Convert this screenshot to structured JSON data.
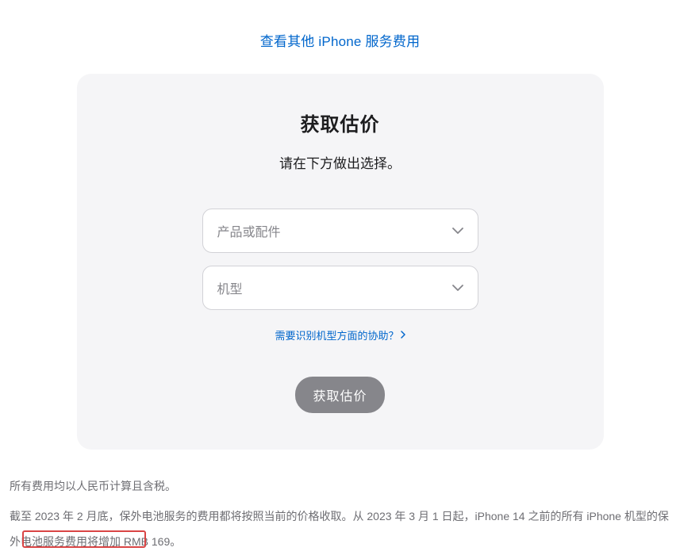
{
  "topLink": {
    "text": "查看其他 iPhone 服务费用"
  },
  "card": {
    "title": "获取估价",
    "subtitle": "请在下方做出选择。",
    "select1": {
      "placeholder": "产品或配件"
    },
    "select2": {
      "placeholder": "机型"
    },
    "helpLink": {
      "text": "需要识别机型方面的协助？"
    },
    "submitButton": {
      "label": "获取估价"
    }
  },
  "footer": {
    "para1": "所有费用均以人民币计算且含税。",
    "para2": "截至 2023 年 2 月底，保外电池服务的费用都将按照当前的价格收取。从 2023 年 3 月 1 日起，iPhone 14 之前的所有 iPhone 机型的保外电池服务费用将增加 RMB 169。"
  }
}
